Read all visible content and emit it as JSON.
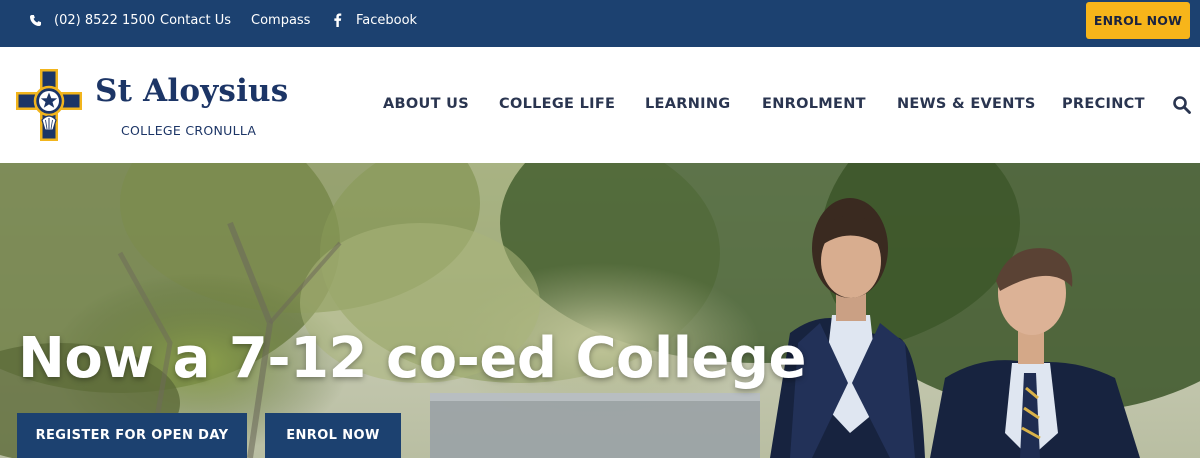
{
  "topbar": {
    "phone": {
      "icon": "phone-icon",
      "label": "(02) 8522 1500"
    },
    "contact_label": "Contact Us",
    "compass_label": "Compass",
    "facebook": {
      "icon": "facebook-icon",
      "label": "Facebook"
    },
    "enrol_label": "ENROL NOW"
  },
  "brand": {
    "name": "St Aloysius",
    "subtitle": "COLLEGE CRONULLA",
    "crest_icon": "college-crest-logo"
  },
  "nav": {
    "items": [
      {
        "label": "ABOUT US"
      },
      {
        "label": "COLLEGE LIFE"
      },
      {
        "label": "LEARNING"
      },
      {
        "label": "ENROLMENT"
      },
      {
        "label": "NEWS & EVENTS"
      },
      {
        "label": "PRECINCT"
      }
    ],
    "search_icon": "search-icon"
  },
  "hero": {
    "title": "Now a 7-12 co-ed College",
    "buttons": [
      {
        "label": "REGISTER FOR OPEN DAY"
      },
      {
        "label": "ENROL NOW"
      }
    ]
  },
  "colors": {
    "navy": "#1c4170",
    "brand_text": "#1c3566",
    "accent_yellow": "#f7b51a"
  }
}
